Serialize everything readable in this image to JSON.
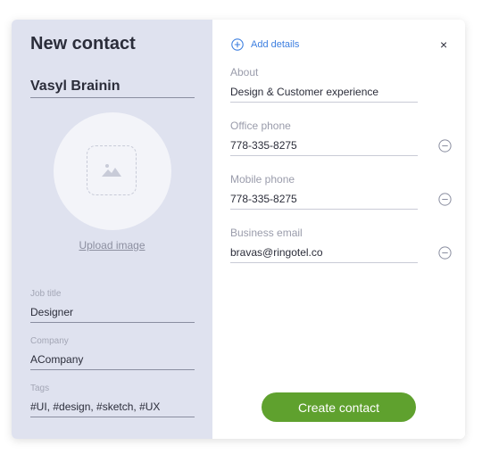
{
  "dialog": {
    "title": "New contact",
    "name": "Vasyl Brainin",
    "upload_label": "Upload image"
  },
  "left_fields": [
    {
      "label": "Job title",
      "value": "Designer"
    },
    {
      "label": "Company",
      "value": "ACompany"
    },
    {
      "label": "Tags",
      "value": "#UI, #design, #sketch, #UX"
    }
  ],
  "add_details_label": "Add details",
  "close_icon": "×",
  "right_fields": [
    {
      "label": "About",
      "value": "Design & Customer experience"
    },
    {
      "label": "Office phone",
      "value": "778-335-8275"
    },
    {
      "label": "Mobile phone",
      "value": "778-335-8275"
    },
    {
      "label": "Business email",
      "value": "bravas@ringotel.co"
    }
  ],
  "create_button": "Create contact",
  "colors": {
    "accent_blue": "#3d7fe0",
    "button_green": "#5fa12e",
    "left_panel": "#dfe2ef"
  },
  "icons": {
    "add": "plus-circle-icon",
    "close": "close-icon",
    "remove": "minus-circle-icon",
    "image": "image-placeholder-icon"
  }
}
